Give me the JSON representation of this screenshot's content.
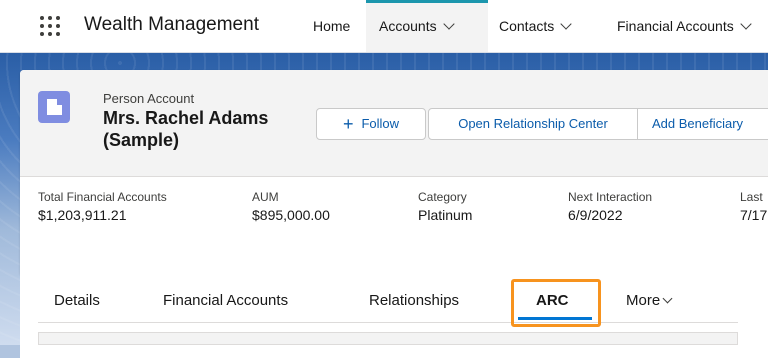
{
  "topnav": {
    "app_name": "Wealth Management",
    "items": [
      {
        "label": "Home"
      },
      {
        "label": "Accounts"
      },
      {
        "label": "Contacts"
      },
      {
        "label": "Financial Accounts"
      }
    ]
  },
  "record": {
    "object_type": "Person Account",
    "name": "Mrs. Rachel Adams (Sample)",
    "icon": "building-icon",
    "accent_color": "#7f8de1"
  },
  "actions": {
    "follow": "Follow",
    "open_relationship_center": "Open Relationship Center",
    "add_beneficiary": "Add Beneficiary"
  },
  "fields": [
    {
      "label": "Total Financial Accounts",
      "value": "$1,203,911.21"
    },
    {
      "label": "AUM",
      "value": "$895,000.00"
    },
    {
      "label": "Category",
      "value": "Platinum"
    },
    {
      "label": "Next Interaction",
      "value": "6/9/2022"
    },
    {
      "label": "Last",
      "value": "7/17"
    }
  ],
  "tabs": [
    {
      "label": "Details"
    },
    {
      "label": "Financial Accounts"
    },
    {
      "label": "Relationships"
    },
    {
      "label": "ARC",
      "active": true
    },
    {
      "label": "More"
    }
  ],
  "colors": {
    "active_tab_accent": "#0176d3",
    "highlight": "#f7931e",
    "nav_active_accent": "#1b96ad"
  }
}
